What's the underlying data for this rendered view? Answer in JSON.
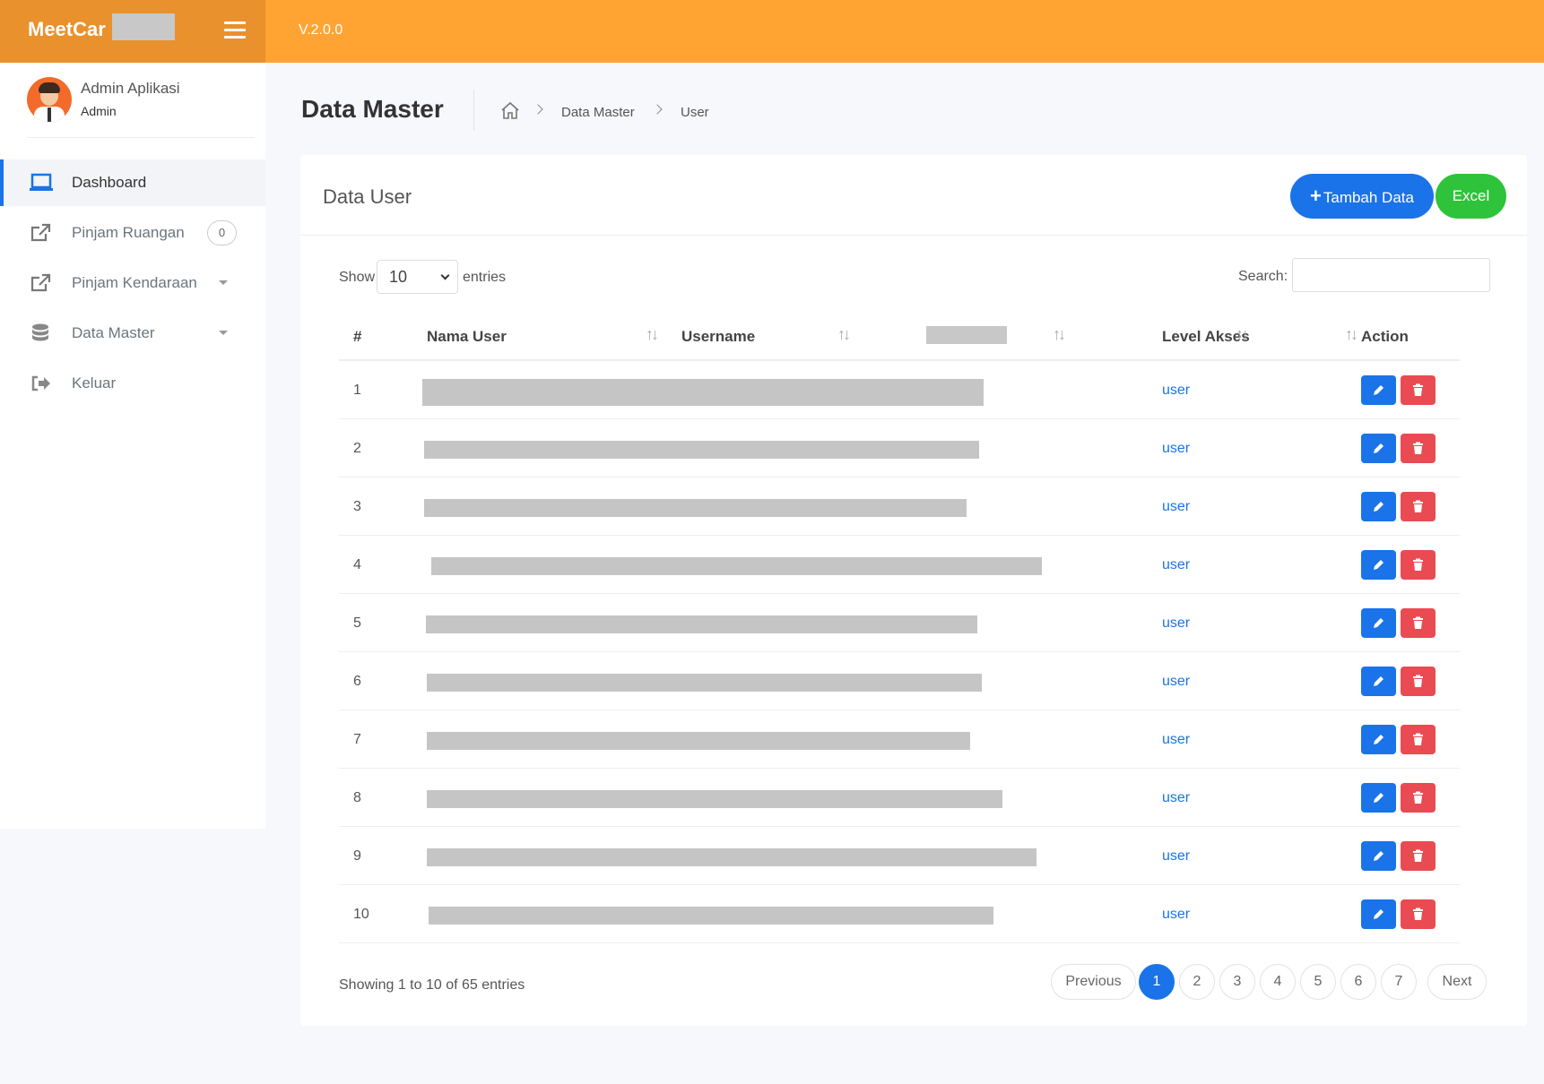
{
  "app": {
    "name": "MeetCar",
    "version": "V.2.0.0"
  },
  "user": {
    "name": "Admin Aplikasi",
    "role": "Admin"
  },
  "sidebar": {
    "items": [
      {
        "label": "Dashboard",
        "icon": "laptop-icon",
        "active": true
      },
      {
        "label": "Pinjam Ruangan",
        "icon": "external-link-icon",
        "badge": "0"
      },
      {
        "label": "Pinjam Kendaraan",
        "icon": "external-link-icon",
        "has_submenu": true
      },
      {
        "label": "Data Master",
        "icon": "database-icon",
        "has_submenu": true
      },
      {
        "label": "Keluar",
        "icon": "sign-out-icon"
      }
    ]
  },
  "header": {
    "title": "Data Master",
    "breadcrumb": [
      "Data Master",
      "User"
    ]
  },
  "card": {
    "title": "Data User",
    "add_button": "Tambah Data",
    "excel_button": "Excel"
  },
  "table": {
    "show_label": "Show",
    "entries_value": "10",
    "entries_label": "entries",
    "search_label": "Search:",
    "headers": [
      "#",
      "Nama User",
      "Username",
      "",
      "Level Akses",
      "Action"
    ],
    "rows": [
      {
        "num": "1",
        "level": "user"
      },
      {
        "num": "2",
        "level": "user"
      },
      {
        "num": "3",
        "level": "user"
      },
      {
        "num": "4",
        "level": "user"
      },
      {
        "num": "5",
        "level": "user"
      },
      {
        "num": "6",
        "level": "user"
      },
      {
        "num": "7",
        "level": "user"
      },
      {
        "num": "8",
        "level": "user"
      },
      {
        "num": "9",
        "level": "user"
      },
      {
        "num": "10",
        "level": "user"
      }
    ],
    "info": "Showing 1 to 10 of 65 entries"
  },
  "pagination": {
    "previous": "Previous",
    "pages": [
      "1",
      "2",
      "3",
      "4",
      "5",
      "6",
      "7"
    ],
    "current": "1",
    "next": "Next"
  },
  "colors": {
    "topbar": "#ffa433",
    "brand": "#e8912d",
    "primary": "#1a73e8",
    "success": "#2ec33a",
    "danger": "#ea4a52"
  }
}
